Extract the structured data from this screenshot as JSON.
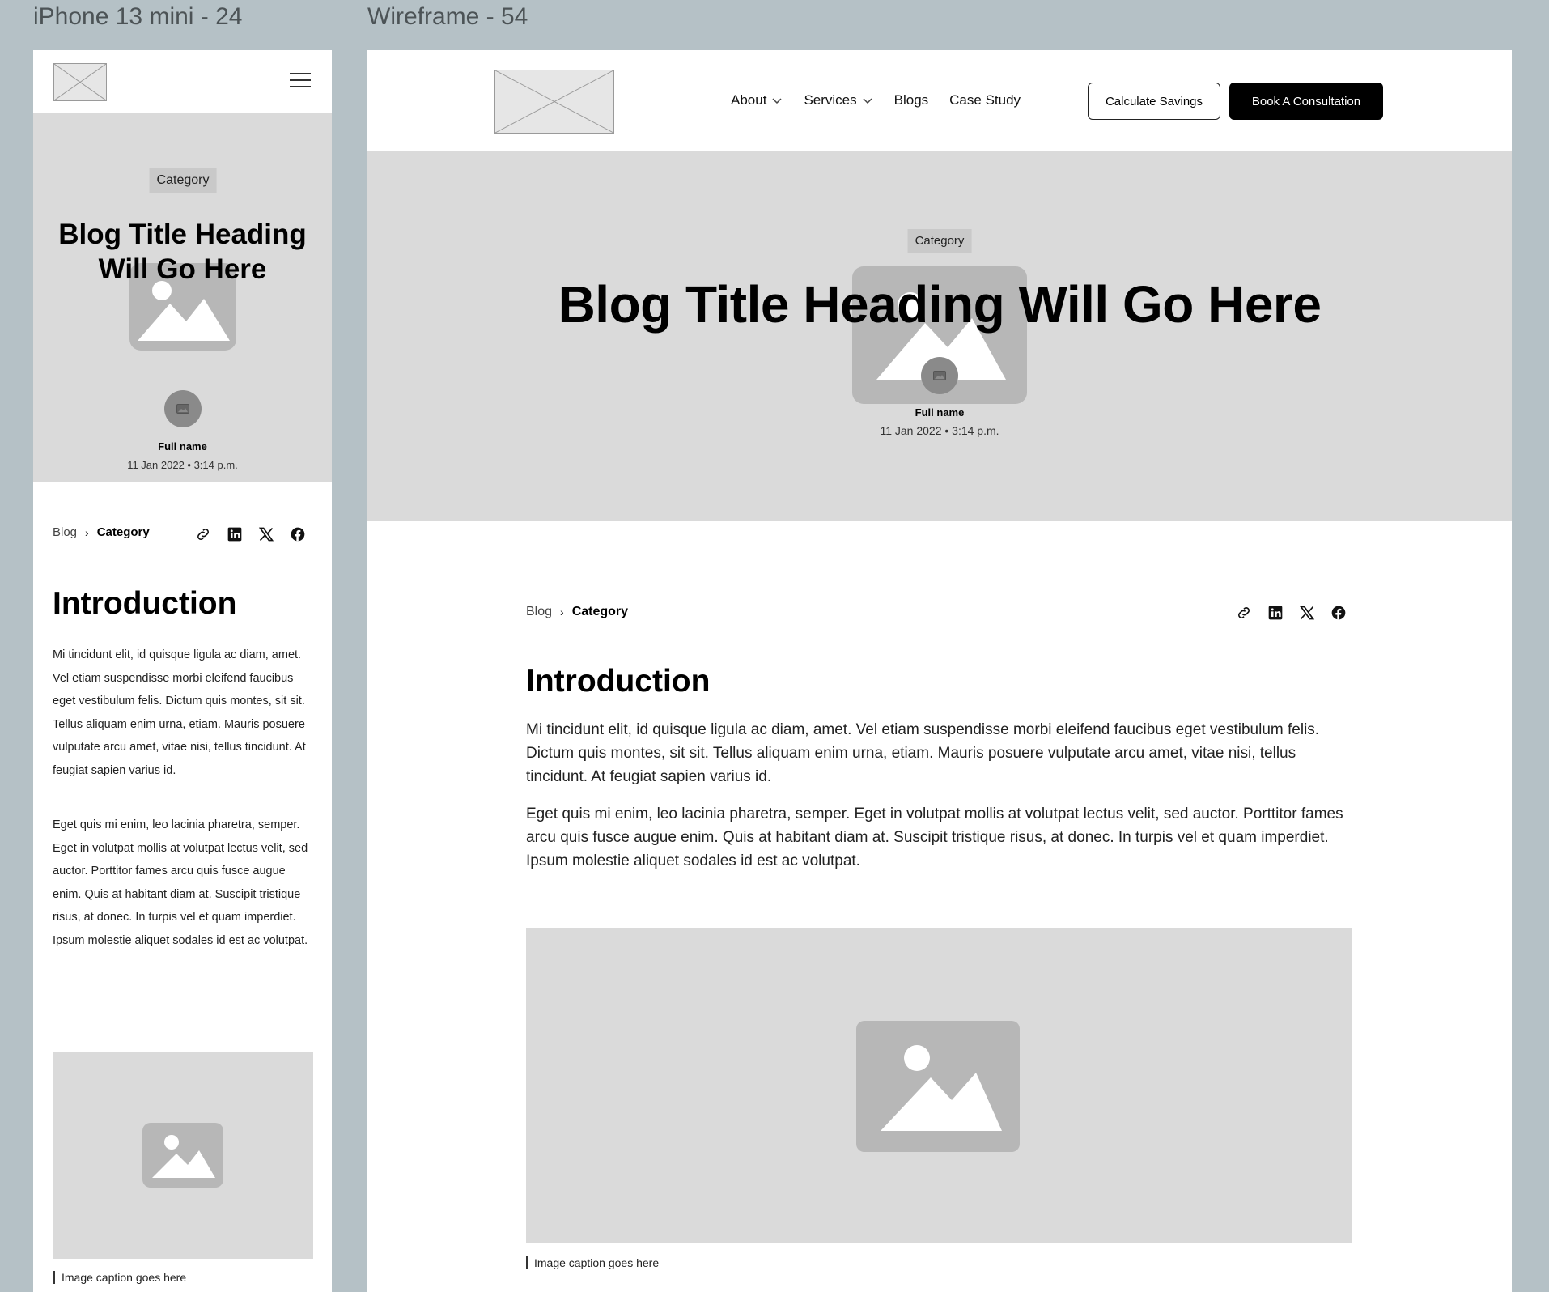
{
  "canvas": {
    "mobile_frame_label": "iPhone 13 mini - 24",
    "desktop_frame_label": "Wireframe - 54"
  },
  "header": {
    "nav": [
      {
        "label": "About",
        "dropdown": true
      },
      {
        "label": "Services",
        "dropdown": true
      },
      {
        "label": "Blogs",
        "dropdown": false
      },
      {
        "label": "Case Study",
        "dropdown": false
      }
    ],
    "secondary_button": "Calculate Savings",
    "primary_button": "Book A Consultation"
  },
  "hero": {
    "category": "Category",
    "title": "Blog Title Heading Will Go Here",
    "author_name": "Full name",
    "date_time": "11 Jan 2022  •  3:14 p.m."
  },
  "breadcrumb": {
    "root": "Blog",
    "current": "Category"
  },
  "share_icons": [
    "link-icon",
    "linkedin-icon",
    "x-icon",
    "facebook-icon"
  ],
  "article": {
    "heading": "Introduction",
    "paragraphs": [
      "Mi tincidunt elit, id quisque ligula ac diam, amet. Vel etiam suspendisse morbi eleifend faucibus eget vestibulum felis. Dictum quis montes, sit sit. Tellus aliquam enim urna, etiam. Mauris posuere vulputate arcu amet, vitae nisi, tellus tincidunt. At feugiat sapien varius id.",
      "Eget quis mi enim, leo lacinia pharetra, semper. Eget in volutpat mollis at volutpat lectus velit, sed auctor. Porttitor fames arcu quis fusce augue enim. Quis at habitant diam at. Suscipit tristique risus, at donec. In turpis vel et quam imperdiet. Ipsum molestie aliquet sodales id est ac volutpat."
    ],
    "image_caption": "Image caption goes here"
  },
  "colors": {
    "canvas_bg": "#b5c1c6",
    "hero_bg": "#dadada",
    "placeholder_fill": "#b7b7b7",
    "primary_button_bg": "#000000"
  }
}
